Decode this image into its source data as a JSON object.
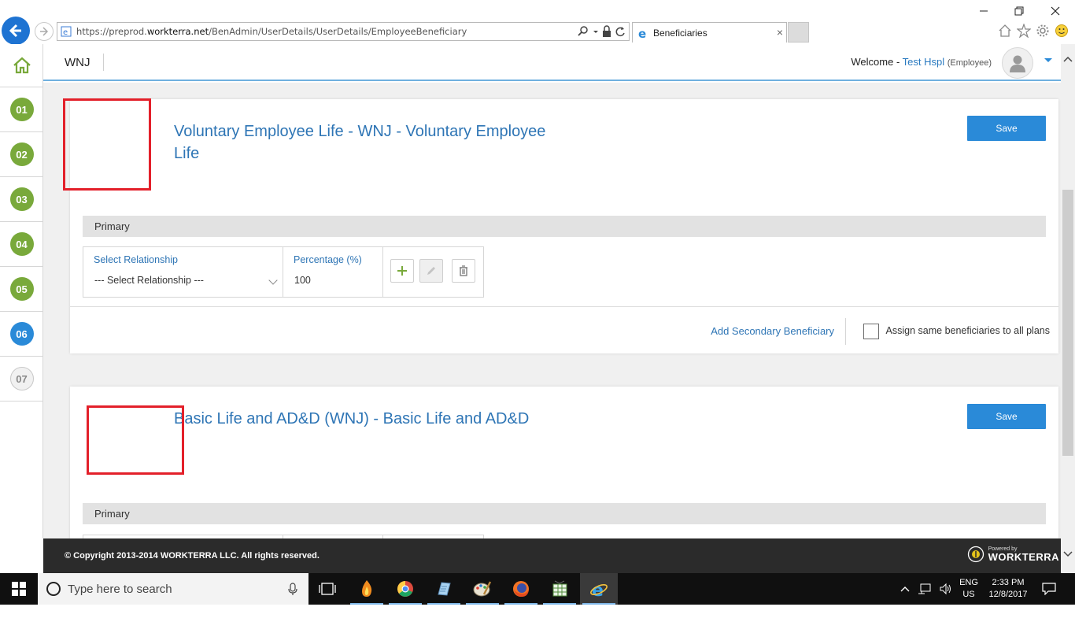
{
  "browser": {
    "url_prefix": "https://preprod.",
    "url_domain": "workterra.net",
    "url_path": "/BenAdmin/UserDetails/UserDetails/EmployeeBeneficiary",
    "tab_title": "Beneficiaries",
    "tab_close": "×"
  },
  "header": {
    "org": "WNJ",
    "welcome_prefix": "Welcome - ",
    "user_name": "Test Hspl",
    "user_role": "(Employee)"
  },
  "steps": [
    {
      "label": "01",
      "state": "done"
    },
    {
      "label": "02",
      "state": "done"
    },
    {
      "label": "03",
      "state": "done"
    },
    {
      "label": "04",
      "state": "done"
    },
    {
      "label": "05",
      "state": "done"
    },
    {
      "label": "06",
      "state": "current"
    },
    {
      "label": "07",
      "state": "pending"
    }
  ],
  "plans": [
    {
      "title": "Voluntary Employee Life - WNJ - Voluntary Employee Life",
      "save_label": "Save",
      "section_label": "Primary",
      "relationship_label": "Select Relationship",
      "relationship_value": "--- Select Relationship ---",
      "percentage_label": "Percentage (%)",
      "percentage_value": "100",
      "add_secondary": "Add Secondary Beneficiary",
      "assign_all": "Assign same beneficiaries to all plans"
    },
    {
      "title": "Basic Life and AD&D (WNJ) - Basic Life and AD&D",
      "save_label": "Save",
      "section_label": "Primary"
    }
  ],
  "footer": {
    "copyright": "© Copyright 2013-2014 WORKTERRA LLC. All rights reserved.",
    "powered_by": "Powered by",
    "brand": "WORKTERRA"
  },
  "taskbar": {
    "search_placeholder": "Type here to search",
    "lang_top": "ENG",
    "lang_bottom": "US",
    "time": "2:33 PM",
    "date": "12/8/2017"
  },
  "colors": {
    "accent": "#2a8ad8",
    "link": "#2e75b5",
    "step_done": "#79a93b",
    "annotation_box": "#e3202a"
  }
}
